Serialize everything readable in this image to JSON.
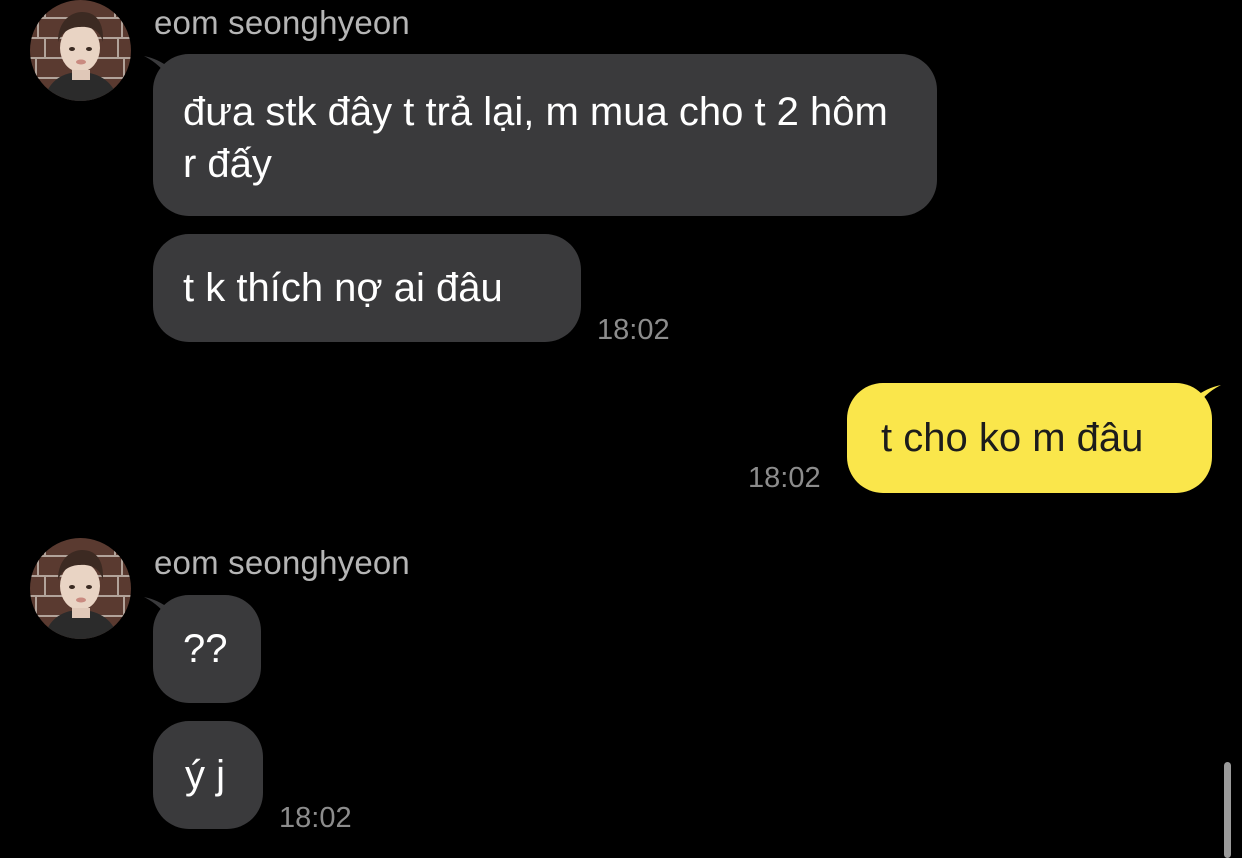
{
  "conversation": {
    "groups": [
      {
        "sender": "eom seonghyeon",
        "messages": [
          "đưa stk đây t trả lại, m mua cho t 2 hôm r đấy",
          "t k thích nợ ai đâu"
        ],
        "time": "18:02"
      },
      {
        "sender": "me",
        "messages": [
          "t cho ko m đâu"
        ],
        "time": "18:02"
      },
      {
        "sender": "eom seonghyeon",
        "messages": [
          "??",
          "ý j"
        ],
        "time": "18:02"
      }
    ]
  },
  "colors": {
    "background": "#000000",
    "incoming_bubble": "#3a3a3c",
    "outgoing_bubble": "#fae64b",
    "sender_name": "#b5b5b5",
    "timestamp": "#8c8c8c"
  },
  "icons": {
    "avatar": "profile-photo"
  }
}
